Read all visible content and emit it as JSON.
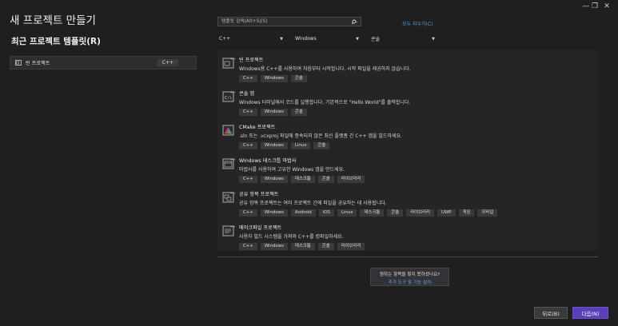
{
  "window": {
    "minimize": "—",
    "restore": "❐",
    "close": "✕"
  },
  "page_title": "새 프로젝트 만들기",
  "recent": {
    "heading": "최근 프로젝트 템플릿(R)",
    "items": [
      {
        "label": "빈 프로젝트",
        "tag": "C++"
      }
    ]
  },
  "search": {
    "placeholder": "템플릿 검색(Alt+S)(S)",
    "value": ""
  },
  "clear_all": "모두 지우기(C)",
  "filters": {
    "language": "C++",
    "platform": "Windows",
    "project_type": "콘솔"
  },
  "templates": [
    {
      "name": "빈 프로젝트",
      "desc": "Windows용 C++를 사용하여 처음부터 시작합니다. 시작 파일을 제공하지 않습니다.",
      "tags": [
        "C++",
        "Windows",
        "콘솔"
      ],
      "icon": "empty-project-icon"
    },
    {
      "name": "콘솔 앱",
      "desc": "Windows 터미널에서 코드를 실행합니다. 기본적으로 \"Hello World\"를 출력합니다.",
      "tags": [
        "C++",
        "Windows",
        "콘솔"
      ],
      "icon": "console-app-icon"
    },
    {
      "name": "CMake 프로젝트",
      "desc": ".sln 또는 .vcxproj 파일에 종속되지 않은 최신 플랫폼 간 C++ 앱을 빌드하세요.",
      "tags": [
        "C++",
        "Windows",
        "Linux",
        "콘솔"
      ],
      "icon": "cmake-project-icon"
    },
    {
      "name": "Windows 데스크톱 마법사",
      "desc": "마법사를 사용하여 고유한 Windows 앱을 만드세요.",
      "tags": [
        "C++",
        "Windows",
        "데스크톱",
        "콘솔",
        "라이브러리"
      ],
      "icon": "desktop-wizard-icon"
    },
    {
      "name": "공유 항목 프로젝트",
      "desc": "공유 항목 프로젝트는 여러 프로젝트 간에 파일을 공유하는 데 사용됩니다.",
      "tags": [
        "C++",
        "Windows",
        "Android",
        "iOS",
        "Linux",
        "데스크톱",
        "콘솔",
        "라이브러리",
        "UWP",
        "게임",
        "모바일"
      ],
      "icon": "shared-items-icon"
    },
    {
      "name": "메이크파일 프로젝트",
      "desc": "사용자 빌드 시스템을 가져와 C++를 컴파일하세요.",
      "tags": [
        "C++",
        "Windows",
        "데스크톱",
        "콘솔",
        "라이브러리"
      ],
      "icon": "makefile-project-icon"
    }
  ],
  "not_found": {
    "question": "원하는 항목을 찾지 못하셨나요?",
    "link": "추가 도구 및 기능 설치"
  },
  "buttons": {
    "back": "뒤로(B)",
    "next": "다음(N)"
  },
  "colors": {
    "background": "#1f1f1f",
    "accent": "#5b3fb8",
    "link": "#5aa0e8"
  }
}
